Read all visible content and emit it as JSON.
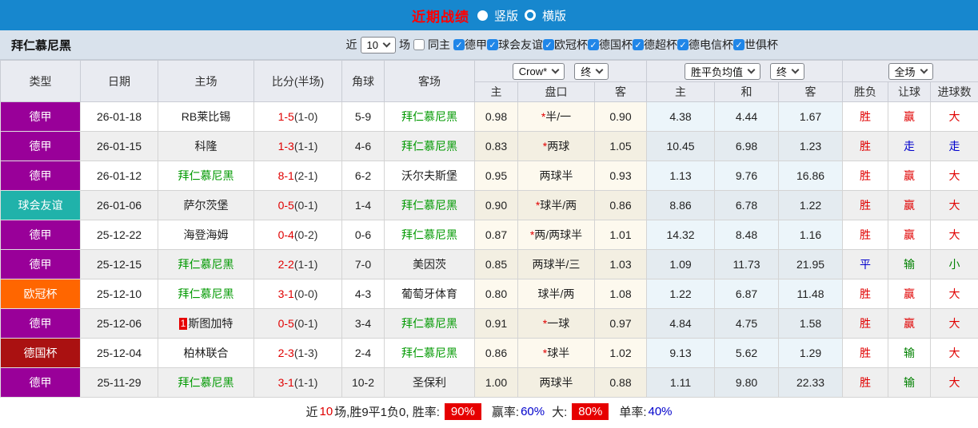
{
  "topbar": {
    "title": "近期战绩",
    "radio_vertical": "竖版",
    "radio_horizontal": "横版"
  },
  "filterbar": {
    "team": "拜仁慕尼黑",
    "near_label": "近",
    "games_count": "10",
    "games_label": "场",
    "same_home_label": "同主",
    "leagues": [
      "德甲",
      "球会友谊",
      "欧冠杯",
      "德国杯",
      "德超杯",
      "德电信杯",
      "世俱杯"
    ]
  },
  "table": {
    "headers_left": [
      "类型",
      "日期",
      "主场",
      "比分(半场)",
      "角球",
      "客场"
    ],
    "odds_select": "Crow*",
    "odds_period_select": "终",
    "avg_select": "胜平负均值",
    "avg_period_select": "终",
    "scope_select": "全场",
    "sub_headers": [
      "主",
      "盘口",
      "客",
      "主",
      "和",
      "客",
      "胜负",
      "让球",
      "进球数"
    ],
    "rows": [
      {
        "type": "德甲",
        "type_color": "#990099",
        "date": "26-01-18",
        "home": "RB莱比锡",
        "home_green": false,
        "home_badge": "",
        "score": "1-5",
        "half": "(1-0)",
        "corners": "5-9",
        "away": "拜仁慕尼黑",
        "away_green": true,
        "odds_home": "0.98",
        "handicap_star": true,
        "handicap": "半/一",
        "odds_away": "0.90",
        "avg_home": "4.38",
        "avg_draw": "4.44",
        "avg_away": "1.67",
        "result": "胜",
        "result_color": "red",
        "let_result": "赢",
        "let_color": "red",
        "goal_result": "大",
        "goal_color": "red"
      },
      {
        "type": "德甲",
        "type_color": "#990099",
        "date": "26-01-15",
        "home": "科隆",
        "home_green": false,
        "home_badge": "",
        "score": "1-3",
        "half": "(1-1)",
        "corners": "4-6",
        "away": "拜仁慕尼黑",
        "away_green": true,
        "odds_home": "0.83",
        "handicap_star": true,
        "handicap": "两球",
        "odds_away": "1.05",
        "avg_home": "10.45",
        "avg_draw": "6.98",
        "avg_away": "1.23",
        "result": "胜",
        "result_color": "red",
        "let_result": "走",
        "let_color": "blue",
        "goal_result": "走",
        "goal_color": "blue"
      },
      {
        "type": "德甲",
        "type_color": "#990099",
        "date": "26-01-12",
        "home": "拜仁慕尼黑",
        "home_green": true,
        "home_badge": "",
        "score": "8-1",
        "half": "(2-1)",
        "corners": "6-2",
        "away": "沃尔夫斯堡",
        "away_green": false,
        "odds_home": "0.95",
        "handicap_star": false,
        "handicap": "两球半",
        "odds_away": "0.93",
        "avg_home": "1.13",
        "avg_draw": "9.76",
        "avg_away": "16.86",
        "result": "胜",
        "result_color": "red",
        "let_result": "赢",
        "let_color": "red",
        "goal_result": "大",
        "goal_color": "red"
      },
      {
        "type": "球会友谊",
        "type_color": "#20b2aa",
        "date": "26-01-06",
        "home": "萨尔茨堡",
        "home_green": false,
        "home_badge": "",
        "score": "0-5",
        "half": "(0-1)",
        "corners": "1-4",
        "away": "拜仁慕尼黑",
        "away_green": true,
        "odds_home": "0.90",
        "handicap_star": true,
        "handicap": "球半/两",
        "odds_away": "0.86",
        "avg_home": "8.86",
        "avg_draw": "6.78",
        "avg_away": "1.22",
        "result": "胜",
        "result_color": "red",
        "let_result": "赢",
        "let_color": "red",
        "goal_result": "大",
        "goal_color": "red"
      },
      {
        "type": "德甲",
        "type_color": "#990099",
        "date": "25-12-22",
        "home": "海登海姆",
        "home_green": false,
        "home_badge": "",
        "score": "0-4",
        "half": "(0-2)",
        "corners": "0-6",
        "away": "拜仁慕尼黑",
        "away_green": true,
        "odds_home": "0.87",
        "handicap_star": true,
        "handicap": "两/两球半",
        "odds_away": "1.01",
        "avg_home": "14.32",
        "avg_draw": "8.48",
        "avg_away": "1.16",
        "result": "胜",
        "result_color": "red",
        "let_result": "赢",
        "let_color": "red",
        "goal_result": "大",
        "goal_color": "red"
      },
      {
        "type": "德甲",
        "type_color": "#990099",
        "date": "25-12-15",
        "home": "拜仁慕尼黑",
        "home_green": true,
        "home_badge": "",
        "score": "2-2",
        "half": "(1-1)",
        "corners": "7-0",
        "away": "美因茨",
        "away_green": false,
        "odds_home": "0.85",
        "handicap_star": false,
        "handicap": "两球半/三",
        "odds_away": "1.03",
        "avg_home": "1.09",
        "avg_draw": "11.73",
        "avg_away": "21.95",
        "result": "平",
        "result_color": "blue",
        "let_result": "输",
        "let_color": "green",
        "goal_result": "小",
        "goal_color": "green"
      },
      {
        "type": "欧冠杯",
        "type_color": "#ff6600",
        "date": "25-12-10",
        "home": "拜仁慕尼黑",
        "home_green": true,
        "home_badge": "",
        "score": "3-1",
        "half": "(0-0)",
        "corners": "4-3",
        "away": "葡萄牙体育",
        "away_green": false,
        "odds_home": "0.80",
        "handicap_star": false,
        "handicap": "球半/两",
        "odds_away": "1.08",
        "avg_home": "1.22",
        "avg_draw": "6.87",
        "avg_away": "11.48",
        "result": "胜",
        "result_color": "red",
        "let_result": "赢",
        "let_color": "red",
        "goal_result": "大",
        "goal_color": "red"
      },
      {
        "type": "德甲",
        "type_color": "#990099",
        "date": "25-12-06",
        "home": "斯图加特",
        "home_green": false,
        "home_badge": "1",
        "score": "0-5",
        "half": "(0-1)",
        "corners": "3-4",
        "away": "拜仁慕尼黑",
        "away_green": true,
        "odds_home": "0.91",
        "handicap_star": true,
        "handicap": "一球",
        "odds_away": "0.97",
        "avg_home": "4.84",
        "avg_draw": "4.75",
        "avg_away": "1.58",
        "result": "胜",
        "result_color": "red",
        "let_result": "赢",
        "let_color": "red",
        "goal_result": "大",
        "goal_color": "red"
      },
      {
        "type": "德国杯",
        "type_color": "#aa1111",
        "date": "25-12-04",
        "home": "柏林联合",
        "home_green": false,
        "home_badge": "",
        "score": "2-3",
        "half": "(1-3)",
        "corners": "2-4",
        "away": "拜仁慕尼黑",
        "away_green": true,
        "odds_home": "0.86",
        "handicap_star": true,
        "handicap": "球半",
        "odds_away": "1.02",
        "avg_home": "9.13",
        "avg_draw": "5.62",
        "avg_away": "1.29",
        "result": "胜",
        "result_color": "red",
        "let_result": "输",
        "let_color": "green",
        "goal_result": "大",
        "goal_color": "red"
      },
      {
        "type": "德甲",
        "type_color": "#990099",
        "date": "25-11-29",
        "home": "拜仁慕尼黑",
        "home_green": true,
        "home_badge": "",
        "score": "3-1",
        "half": "(1-1)",
        "corners": "10-2",
        "away": "圣保利",
        "away_green": false,
        "odds_home": "1.00",
        "handicap_star": false,
        "handicap": "两球半",
        "odds_away": "0.88",
        "avg_home": "1.11",
        "avg_draw": "9.80",
        "avg_away": "22.33",
        "result": "胜",
        "result_color": "red",
        "let_result": "输",
        "let_color": "green",
        "goal_result": "大",
        "goal_color": "red"
      }
    ]
  },
  "footer": {
    "near_label": "近",
    "count": "10",
    "record": "场,胜9平1负0, 胜率:",
    "win_rate": "90%",
    "handicap_label": "赢率:",
    "handicap_rate": "60%",
    "big_label": "大:",
    "big_rate": "80%",
    "single_label": "单率:",
    "single_rate": "40%"
  },
  "colors": {
    "topbar_blue": "#1787ce",
    "title_red": "#ff0000",
    "bundesliga_purple": "#990099",
    "friendly_teal": "#20b2aa",
    "ucl_orange": "#ff6600",
    "dfb_cup_dark_red": "#aa1111",
    "team_green": "#009900",
    "badge_red": "#e60000"
  }
}
